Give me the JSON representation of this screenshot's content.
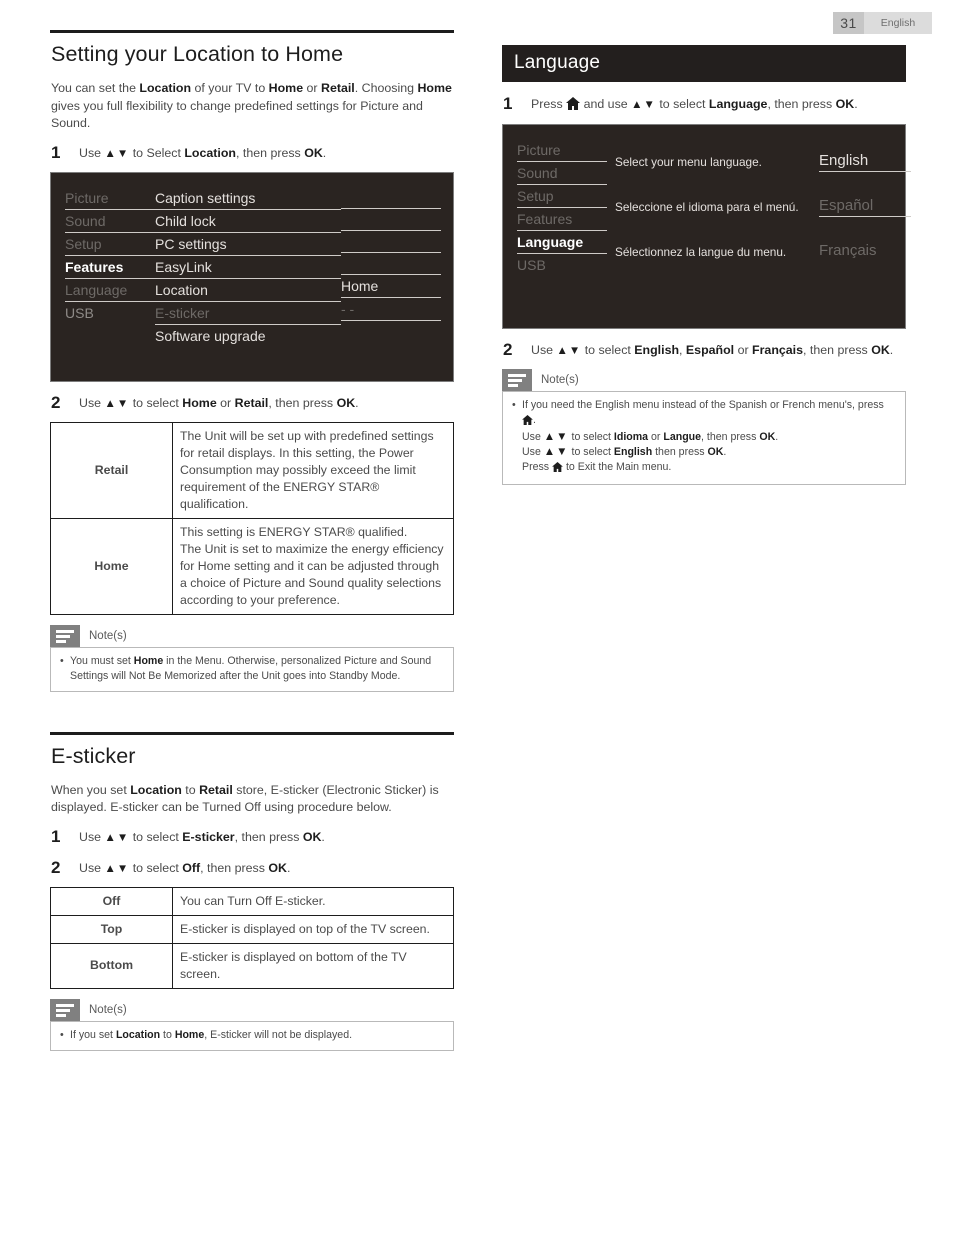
{
  "header": {
    "page_number": "31",
    "language": "English"
  },
  "left_column": {
    "section1": {
      "title": "Setting your Location to Home",
      "intro_parts": [
        "You can set the ",
        "Location",
        " of your TV to ",
        "Home",
        " or ",
        "Retail",
        ". Choosing ",
        "Home",
        " gives you full flexibility to change predefined settings for Picture and Sound."
      ],
      "step1": {
        "num": "1",
        "text_pre": "Use ",
        "arrows": "▲▼",
        "text_mid": " to Select ",
        "bold1": "Location",
        "text_post": ", then press ",
        "bold2": "OK",
        "text_end": "."
      },
      "tv_menu": {
        "left_items": [
          {
            "label": "Picture",
            "state": "dim"
          },
          {
            "label": "Sound",
            "state": "dim"
          },
          {
            "label": "Setup",
            "state": "dim"
          },
          {
            "label": "Features",
            "state": "active"
          },
          {
            "label": "Language",
            "state": "dim"
          },
          {
            "label": "USB",
            "state": "normal"
          }
        ],
        "middle_items": [
          {
            "label": "Caption settings",
            "state": "normal"
          },
          {
            "label": "Child lock",
            "state": "normal"
          },
          {
            "label": "PC settings",
            "state": "normal"
          },
          {
            "label": "EasyLink",
            "state": "normal"
          },
          {
            "label": "Location",
            "state": "normal"
          },
          {
            "label": "E-sticker",
            "state": "dim"
          },
          {
            "label": "Software upgrade",
            "state": "normal"
          }
        ],
        "right_items": [
          {
            "label": "",
            "state": "empty"
          },
          {
            "label": "",
            "state": "empty"
          },
          {
            "label": "",
            "state": "empty"
          },
          {
            "label": "",
            "state": "empty"
          },
          {
            "label": "Home",
            "state": "normal"
          },
          {
            "label": "- -",
            "state": "dim"
          }
        ]
      },
      "step2": {
        "num": "2",
        "text_pre": "Use ",
        "arrows": "▲▼",
        "text_mid": " to select ",
        "bold1": "Home",
        "text_or": " or ",
        "bold2": "Retail",
        "text_post": ", then press ",
        "bold3": "OK",
        "text_end": "."
      },
      "table": {
        "rows": [
          {
            "key": "Retail",
            "desc": "The Unit will be set up with predefined settings for retail displays. In this setting, the Power Consumption may possibly exceed the limit requirement of the ENERGY STAR® qualification."
          },
          {
            "key": "Home",
            "desc": "This setting is ENERGY STAR® qualified.\nThe Unit is set to maximize the energy efficiency for Home setting and it can be adjusted through a choice of Picture and Sound quality selections according to your preference."
          }
        ]
      },
      "note": {
        "label": "Note(s)",
        "lines": [
          {
            "bullet": "•",
            "pre": "You must set ",
            "bold": "Home",
            "post": " in the Menu. Otherwise, personalized Picture and Sound Settings will Not Be Memorized after the Unit goes into Standby Mode."
          }
        ]
      }
    },
    "section2": {
      "title": "E-sticker",
      "intro_parts": [
        "When you set ",
        "Location",
        " to ",
        "Retail",
        " store, E-sticker (Electronic Sticker) is displayed. E-sticker can be Turned Off using procedure below."
      ],
      "step1": {
        "num": "1",
        "text_pre": "Use ",
        "arrows": "▲▼",
        "text_mid": " to select ",
        "bold1": "E-sticker",
        "text_post": ", then press ",
        "bold2": "OK",
        "text_end": "."
      },
      "step2": {
        "num": "2",
        "text_pre": "Use ",
        "arrows": "▲▼",
        "text_mid": " to select ",
        "bold1": "Off",
        "text_post": ", then press ",
        "bold2": "OK",
        "text_end": "."
      },
      "table": {
        "rows": [
          {
            "key": "Off",
            "desc": "You can Turn Off E-sticker."
          },
          {
            "key": "Top",
            "desc": "E-sticker is displayed on top of the TV screen."
          },
          {
            "key": "Bottom",
            "desc": "E-sticker is displayed on bottom of the TV screen."
          }
        ]
      },
      "note": {
        "label": "Note(s)",
        "lines": [
          {
            "bullet": "•",
            "pre": "If you set ",
            "bold": "Location",
            "mid": " to ",
            "bold2": "Home",
            "post": ", E-sticker will not be displayed."
          }
        ]
      }
    }
  },
  "right_column": {
    "section": {
      "title": "Language",
      "step1": {
        "num": "1",
        "text_pre": "Press ",
        "home_icon": "home-icon",
        "text_mid": " and use ",
        "arrows": "▲▼",
        "text_mid2": " to select ",
        "bold1": "Language",
        "text_post": ", then press ",
        "bold2": "OK",
        "text_end": "."
      },
      "tv_menu": {
        "left_items": [
          {
            "label": "Picture",
            "state": "dim"
          },
          {
            "label": "Sound",
            "state": "dim"
          },
          {
            "label": "Setup",
            "state": "dim"
          },
          {
            "label": "Features",
            "state": "dim"
          },
          {
            "label": "Language",
            "state": "active"
          },
          {
            "label": "USB",
            "state": "dim"
          }
        ],
        "descriptions": [
          "Select your menu language.",
          "Seleccione el idioma para el menú.",
          "Sélectionnez la langue du menu."
        ],
        "options": [
          {
            "label": "English",
            "state": "normal"
          },
          {
            "label": "Español",
            "state": "dim"
          },
          {
            "label": "Français",
            "state": "dim-noline"
          }
        ]
      },
      "step2": {
        "num": "2",
        "text_pre": "Use ",
        "arrows": "▲▼",
        "text_mid": " to select ",
        "bold1": "English",
        "sep1": ", ",
        "bold2": "Español",
        "sep2": " or ",
        "bold3": "Français",
        "text_post": ", then press ",
        "bold4": "OK",
        "text_end": "."
      },
      "note": {
        "label": "Note(s)",
        "line1_pre": "If you need the English menu instead of the Spanish or French menu's, press ",
        "line1_post": ".",
        "line2_pre": "Use ",
        "line2_arrows": "▲▼",
        "line2_mid": " to select ",
        "line2_b1": "Idioma",
        "line2_or": " or ",
        "line2_b2": "Langue",
        "line2_post": ", then press ",
        "line2_b3": "OK",
        "line2_end": ".",
        "line3_pre": "Use ",
        "line3_arrows": "▲▼",
        "line3_mid": " to select ",
        "line3_b1": "English",
        "line3_post": " then press ",
        "line3_b2": "OK",
        "line3_end": ".",
        "line4_pre": "Press ",
        "line4_post": " to Exit the Main menu."
      }
    }
  },
  "colors": {
    "menu_bg": "#2a2421",
    "bar_bg": "#231f1e",
    "note_icon": "#808080",
    "page_badge": "#c6c6c6"
  }
}
